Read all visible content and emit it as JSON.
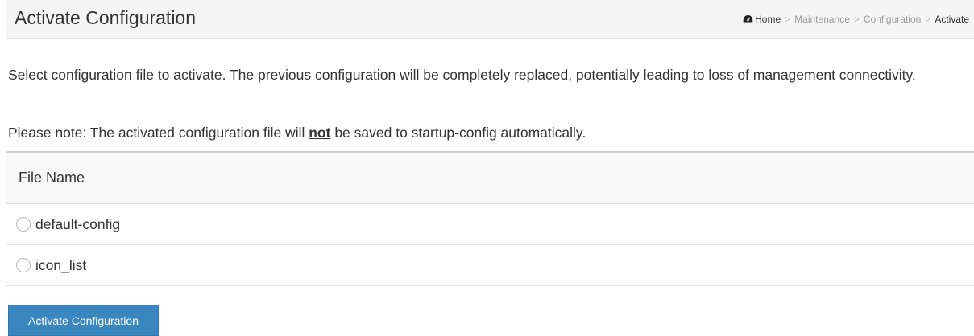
{
  "header": {
    "title": "Activate Configuration",
    "breadcrumb": {
      "home": "Home",
      "items": [
        "Maintenance",
        "Configuration"
      ],
      "current": "Activate",
      "separator": ">"
    }
  },
  "description": "Select configuration file to activate. The previous configuration will be completely replaced, potentially leading to loss of management connectivity.",
  "note": {
    "prefix": "Please note: The activated configuration file will ",
    "emphasis": "not",
    "suffix": " be saved to startup-config automatically."
  },
  "table": {
    "column_header": "File Name",
    "rows": [
      {
        "label": "default-config",
        "selected": false
      },
      {
        "label": "icon_list",
        "selected": false
      }
    ]
  },
  "actions": {
    "activate_label": "Activate Configuration"
  },
  "colors": {
    "button": "#3a87c0",
    "header_bg": "#f5f5f5"
  },
  "icons": {
    "home": "tachometer-home-icon",
    "radio": "radio-button-icon"
  }
}
